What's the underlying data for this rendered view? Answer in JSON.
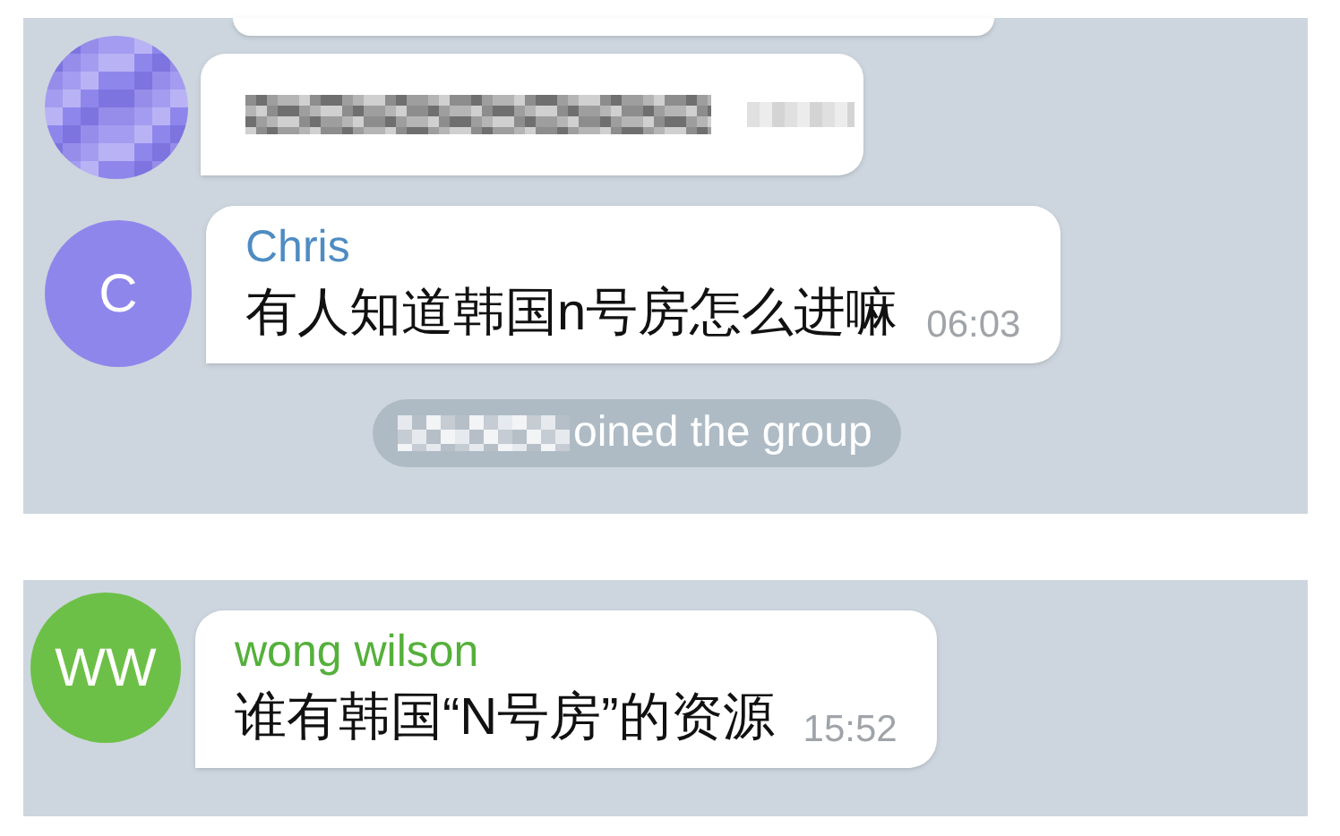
{
  "panels": [
    {
      "messages": [
        {
          "kind": "cut"
        },
        {
          "kind": "redacted"
        },
        {
          "kind": "text",
          "avatar": {
            "initials": "C",
            "color": "#8f86ec"
          },
          "sender": {
            "name": "Chris",
            "color": "#4e8cc2"
          },
          "text": "有人知道韩国n号房怎么进嘛",
          "time": "06:03"
        },
        {
          "kind": "service",
          "text": "oined the group"
        }
      ]
    },
    {
      "messages": [
        {
          "kind": "text",
          "avatar": {
            "initials": "WW",
            "color": "#6dc047"
          },
          "sender": {
            "name": "wong wilson",
            "color": "#55b03b"
          },
          "text": "谁有韩国“N号房”的资源",
          "time": "15:52"
        }
      ]
    }
  ]
}
